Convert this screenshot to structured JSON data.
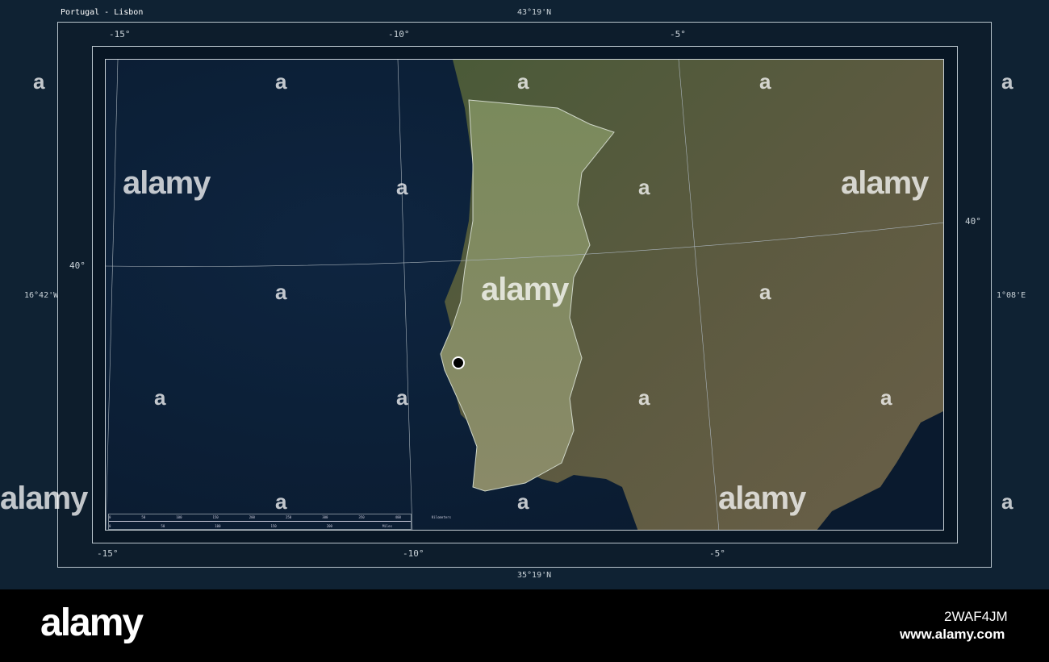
{
  "title": "Portugal - Lisbon",
  "bounds": {
    "north": "43°19'N",
    "south": "35°19'N",
    "west": "16°42'W",
    "east": "1°08'E"
  },
  "graticule": {
    "top": [
      "-15°",
      "-10°",
      "-5°"
    ],
    "bottom": [
      "-15°",
      "-10°",
      "-5°"
    ],
    "left": [
      "40°"
    ],
    "right": [
      "40°"
    ]
  },
  "marker": {
    "city": "Lisbon",
    "color": "#000000"
  },
  "scale_bar": {
    "km_ticks": [
      "0",
      "50",
      "100",
      "150",
      "200",
      "250",
      "300",
      "350",
      "400"
    ],
    "km_unit": "Kilometers",
    "mi_ticks": [
      "0",
      "50",
      "100",
      "150",
      "200"
    ],
    "mi_unit": "Miles"
  },
  "watermark": {
    "text": "alamy",
    "letter": "a"
  },
  "footer": {
    "logo": "alamy",
    "image_id": "2WAF4JM",
    "site": "www.alamy.com"
  }
}
